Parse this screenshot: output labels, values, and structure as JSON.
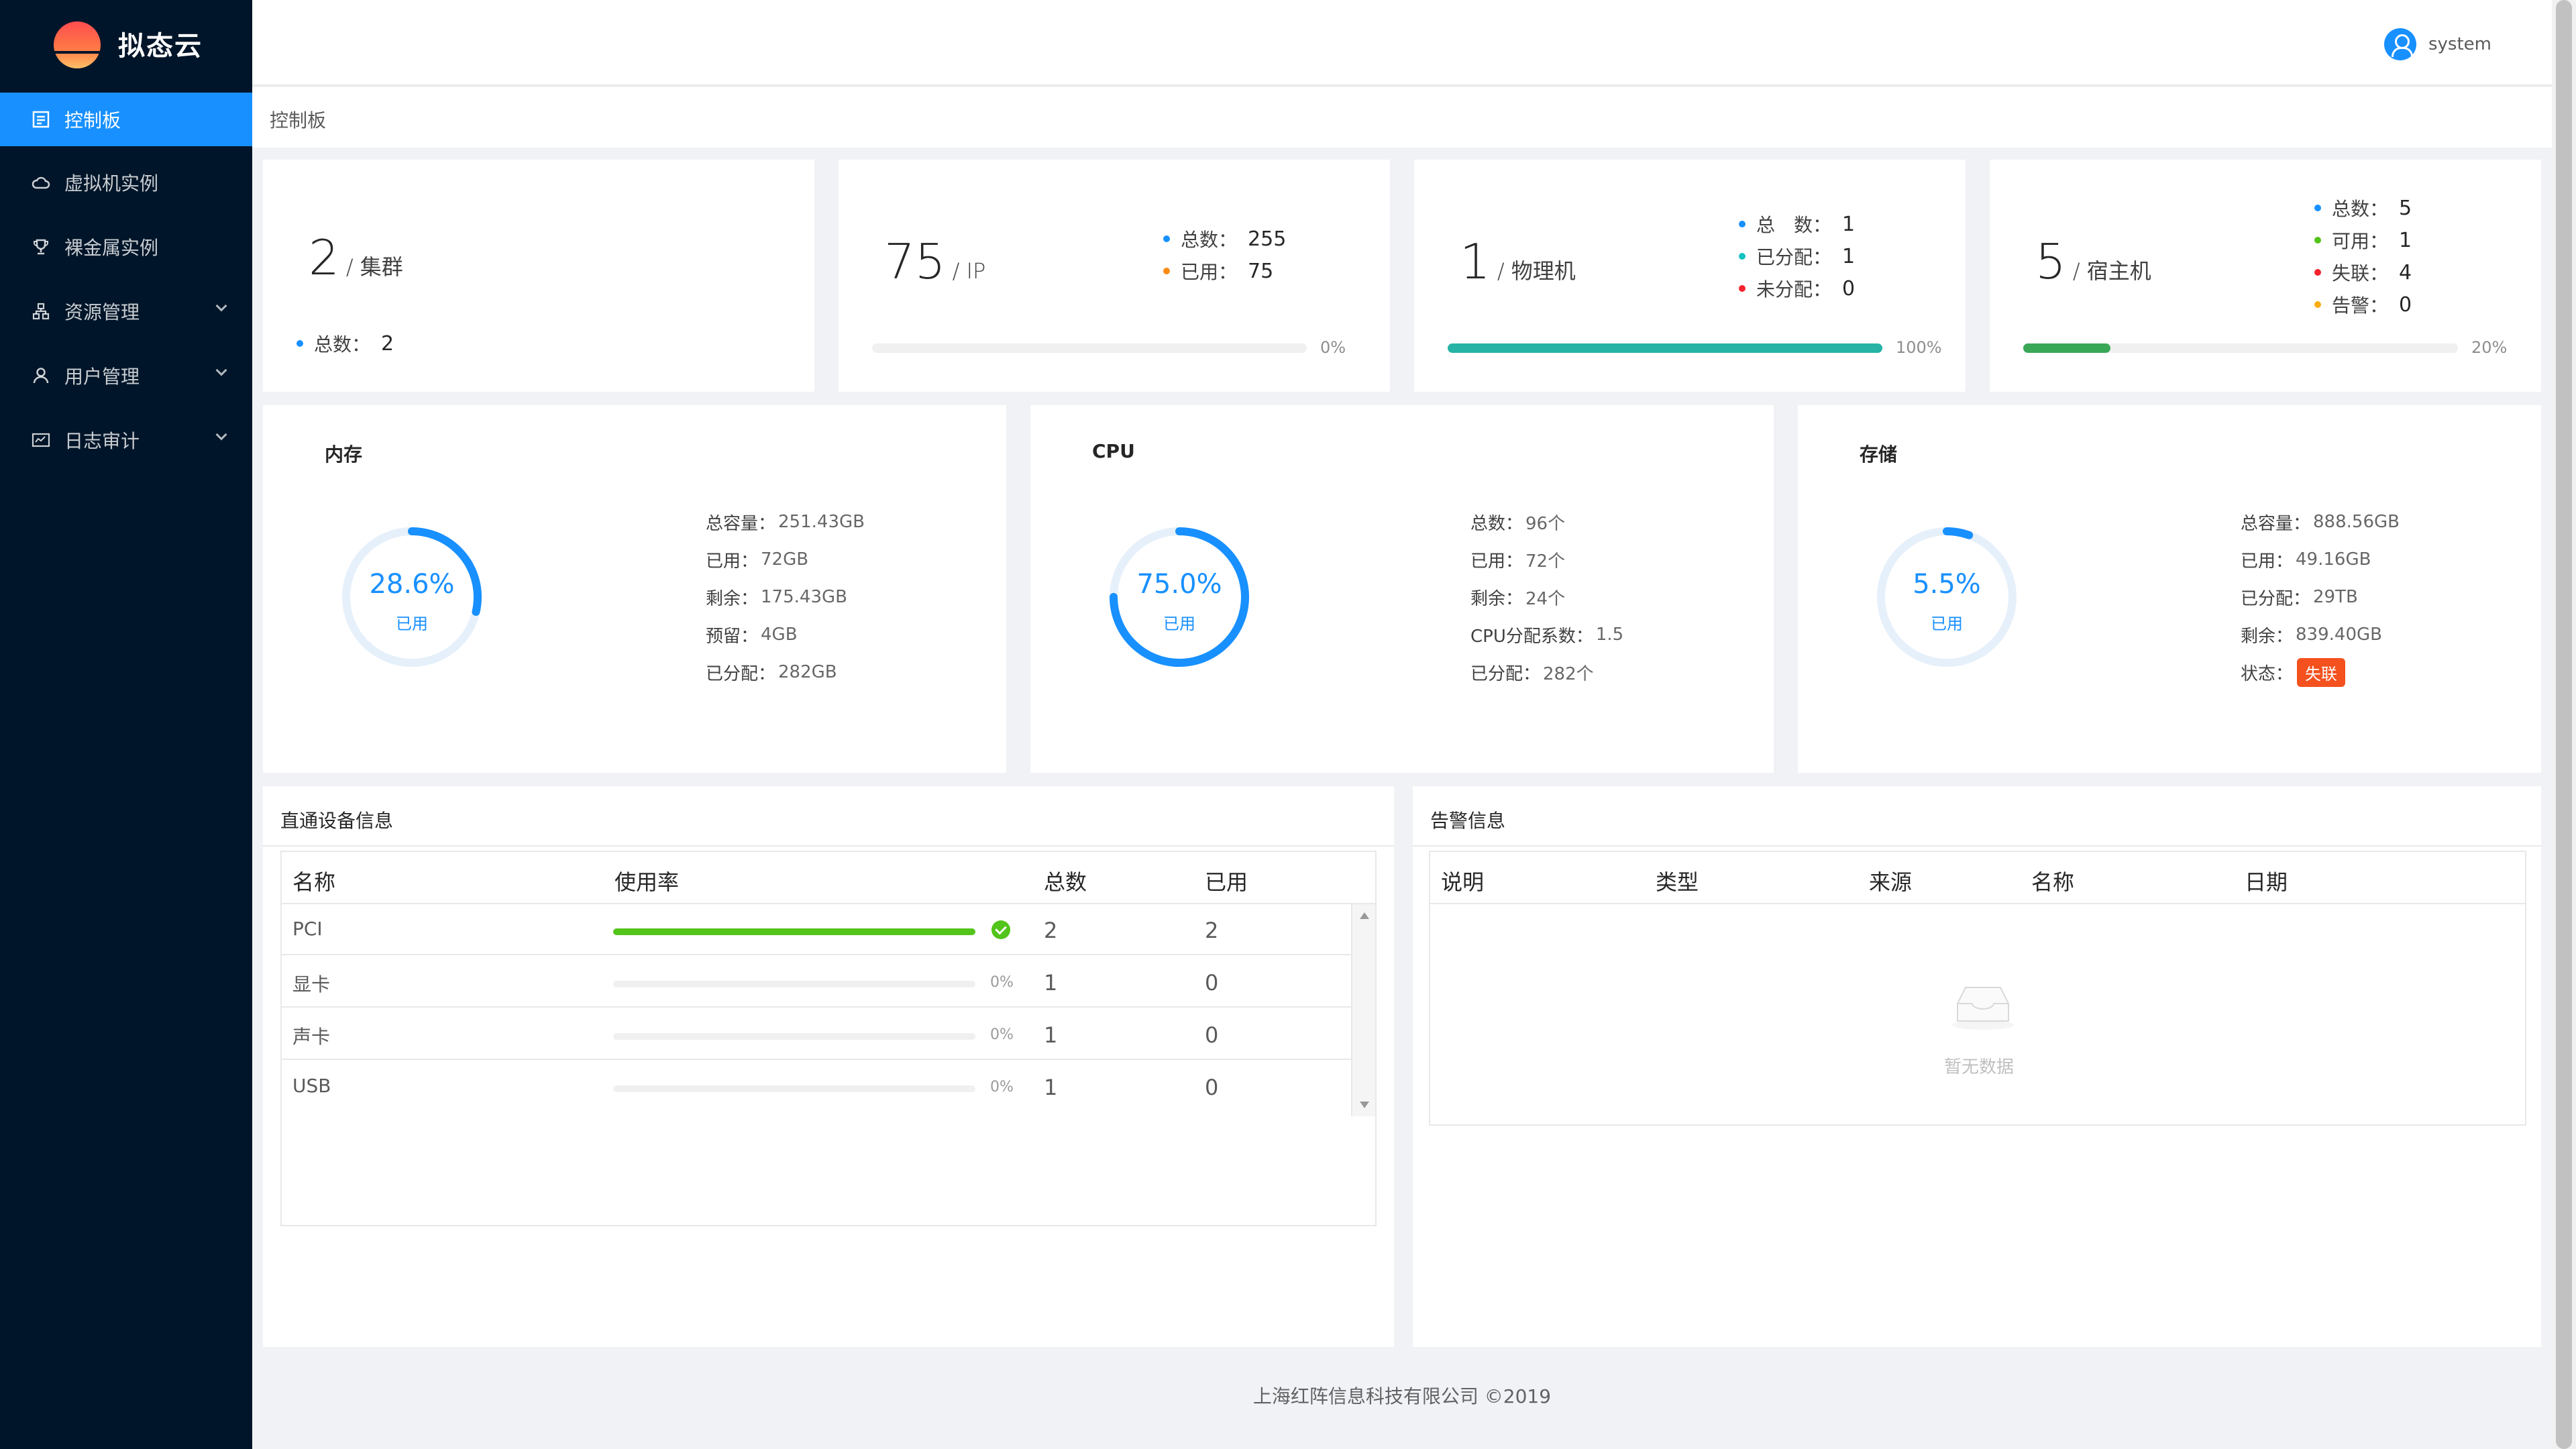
{
  "app": {
    "name": "拟态云"
  },
  "header": {
    "user": "system"
  },
  "sidebar": {
    "items": [
      {
        "label": "控制板",
        "active": true
      },
      {
        "label": "虚拟机实例"
      },
      {
        "label": "裸金属实例"
      },
      {
        "label": "资源管理",
        "has_children": true
      },
      {
        "label": "用户管理",
        "has_children": true
      },
      {
        "label": "日志审计",
        "has_children": true
      }
    ]
  },
  "breadcrumb": "控制板",
  "stats": {
    "cluster": {
      "value": "2",
      "unit": "/ 集群",
      "legend": [
        {
          "label": "总数：",
          "value": "2",
          "color": "#1890ff"
        }
      ]
    },
    "ip": {
      "value": "75",
      "unit": "/ IP",
      "legend": [
        {
          "label": "总数：",
          "value": "255",
          "color": "#1890ff"
        },
        {
          "label": "已用：",
          "value": "75",
          "color": "#fa8c16"
        }
      ],
      "percent": 0,
      "percent_text": "0%",
      "bar_color": "#1890ff"
    },
    "physical": {
      "value": "1",
      "unit": "/ 物理机",
      "legend": [
        {
          "label": "总　数：",
          "value": "1",
          "color": "#1890ff"
        },
        {
          "label": "已分配：",
          "value": "1",
          "color": "#13c2c2"
        },
        {
          "label": "未分配：",
          "value": "0",
          "color": "#f5222d"
        }
      ],
      "percent": 100,
      "percent_text": "100%",
      "bar_color": "#26b3a6"
    },
    "host": {
      "value": "5",
      "unit": "/ 宿主机",
      "legend": [
        {
          "label": "总数：",
          "value": "5",
          "color": "#1890ff"
        },
        {
          "label": "可用：",
          "value": "1",
          "color": "#52c41a"
        },
        {
          "label": "失联：",
          "value": "4",
          "color": "#f5222d"
        },
        {
          "label": "告警：",
          "value": "0",
          "color": "#faad14"
        }
      ],
      "percent": 20,
      "percent_text": "20%",
      "bar_color": "#3aa757"
    }
  },
  "resources": {
    "memory": {
      "title": "内存",
      "percent": 28.6,
      "percent_text": "28.6%",
      "sub": "已用",
      "rows": [
        {
          "label": "总容量：",
          "value": "251.43GB"
        },
        {
          "label": "已用：",
          "value": "72GB"
        },
        {
          "label": "剩余：",
          "value": "175.43GB"
        },
        {
          "label": "预留：",
          "value": "4GB"
        },
        {
          "label": "已分配：",
          "value": "282GB"
        }
      ]
    },
    "cpu": {
      "title": "CPU",
      "percent": 75.0,
      "percent_text": "75.0%",
      "sub": "已用",
      "rows": [
        {
          "label": "总数：",
          "value": "96个"
        },
        {
          "label": "已用：",
          "value": "72个"
        },
        {
          "label": "剩余：",
          "value": "24个"
        },
        {
          "label": "CPU分配系数：",
          "value": "1.5"
        },
        {
          "label": "已分配：",
          "value": "282个"
        }
      ]
    },
    "storage": {
      "title": "存储",
      "percent": 5.5,
      "percent_text": "5.5%",
      "sub": "已用",
      "rows": [
        {
          "label": "总容量：",
          "value": "888.56GB"
        },
        {
          "label": "已用：",
          "value": "49.16GB"
        },
        {
          "label": "已分配：",
          "value": "29TB"
        },
        {
          "label": "剩余：",
          "value": "839.40GB"
        }
      ],
      "status_label": "状态：",
      "status_value": "失联"
    }
  },
  "passthrough": {
    "title": "直通设备信息",
    "columns": [
      "名称",
      "使用率",
      "总数",
      "已用"
    ],
    "rows": [
      {
        "name": "PCI",
        "usage": 100,
        "usage_text": "",
        "total": "2",
        "used": "2"
      },
      {
        "name": "显卡",
        "usage": 0,
        "usage_text": "0%",
        "total": "1",
        "used": "0"
      },
      {
        "name": "声卡",
        "usage": 0,
        "usage_text": "0%",
        "total": "1",
        "used": "0"
      },
      {
        "name": "USB",
        "usage": 0,
        "usage_text": "0%",
        "total": "1",
        "used": "0"
      }
    ]
  },
  "alerts": {
    "title": "告警信息",
    "columns": [
      "说明",
      "类型",
      "来源",
      "名称",
      "日期"
    ],
    "empty_text": "暂无数据"
  },
  "footer": "上海红阵信息科技有限公司 ©2019",
  "colors": {
    "primary": "#1890ff",
    "sidebar": "#001529",
    "success": "#52c41a",
    "danger": "#f4511e"
  }
}
